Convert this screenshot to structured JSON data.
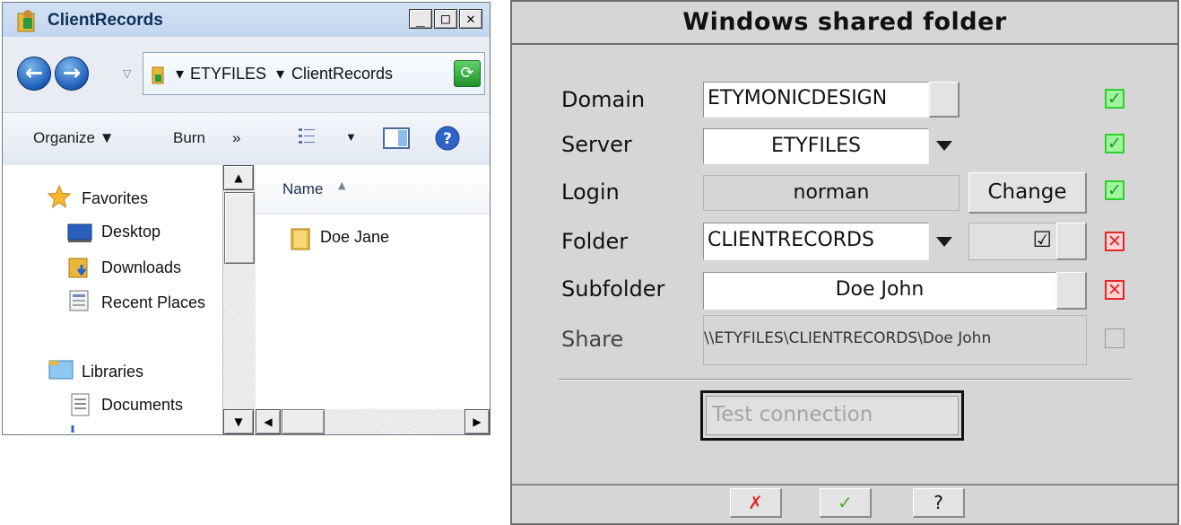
{
  "explorer": {
    "title": "ClientRecords",
    "window_buttons": {
      "minimize": "_",
      "maximize": "□",
      "close": "✕"
    },
    "address": {
      "crumbs": [
        "ETYFILES",
        "ClientRecords"
      ]
    },
    "toolbar": {
      "organize": "Organize",
      "burn": "Burn",
      "more": "»"
    },
    "nav": {
      "favorites": "Favorites",
      "desktop": "Desktop",
      "downloads": "Downloads",
      "recent_places": "Recent Places",
      "libraries": "Libraries",
      "documents": "Documents"
    },
    "content": {
      "column_name": "Name",
      "items": [
        "Doe Jane"
      ]
    }
  },
  "dialog": {
    "title": "Windows shared folder",
    "fields": {
      "domain": {
        "label": "Domain",
        "value": "ETYMONICDESIGN"
      },
      "server": {
        "label": "Server",
        "value": "ETYFILES"
      },
      "login": {
        "label": "Login",
        "value": "norman",
        "button": "Change"
      },
      "folder": {
        "label": "Folder",
        "value": "CLIENTRECORDS",
        "checkbox": "☑"
      },
      "subfolder": {
        "label": "Subfolder",
        "value": "Doe John"
      },
      "share": {
        "label": "Share",
        "value": "\\\\ETYFILES\\CLIENTRECORDS\\Doe John"
      }
    },
    "status": {
      "domain": "ok",
      "server": "ok",
      "login": "ok",
      "folder": "error",
      "subfolder": "error",
      "share": "none"
    },
    "test_button": "Test connection",
    "footer": {
      "cancel": "✗",
      "ok": "✓",
      "help": "?"
    },
    "colors": {
      "ok": "#2fcf2f",
      "error": "#e32626"
    }
  }
}
